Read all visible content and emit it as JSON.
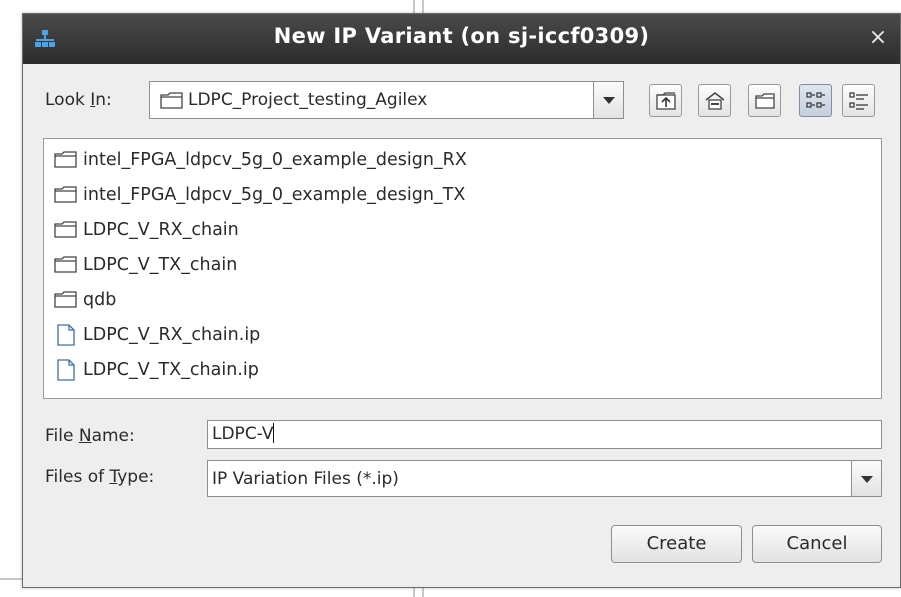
{
  "dialog": {
    "title": "New IP Variant (on sj-iccf0309)",
    "close_glyph": "×",
    "app_icon": "network-tree-icon"
  },
  "look_in": {
    "label_pre": "Look ",
    "label_mnemonic": "I",
    "label_post": "n:",
    "value": "LDPC_Project_testing_Agilex"
  },
  "toolbar": {
    "icons": [
      "up-one-level-icon",
      "home-icon",
      "new-folder-icon",
      "list-view-icon",
      "details-view-icon"
    ]
  },
  "files": [
    {
      "name": "intel_FPGA_ldpcv_5g_0_example_design_RX",
      "type": "folder"
    },
    {
      "name": "intel_FPGA_ldpcv_5g_0_example_design_TX",
      "type": "folder"
    },
    {
      "name": "LDPC_V_RX_chain",
      "type": "folder"
    },
    {
      "name": "LDPC_V_TX_chain",
      "type": "folder"
    },
    {
      "name": "qdb",
      "type": "folder"
    },
    {
      "name": "LDPC_V_RX_chain.ip",
      "type": "file"
    },
    {
      "name": "LDPC_V_TX_chain.ip",
      "type": "file"
    }
  ],
  "file_name": {
    "label_pre": "File ",
    "label_mnemonic": "N",
    "label_post": "ame:",
    "value": "LDPC-V"
  },
  "file_type": {
    "label_pre": "Files of ",
    "label_mnemonic": "T",
    "label_post": "ype:",
    "value": "IP Variation Files (*.ip)"
  },
  "buttons": {
    "create": "Create",
    "cancel": "Cancel"
  }
}
